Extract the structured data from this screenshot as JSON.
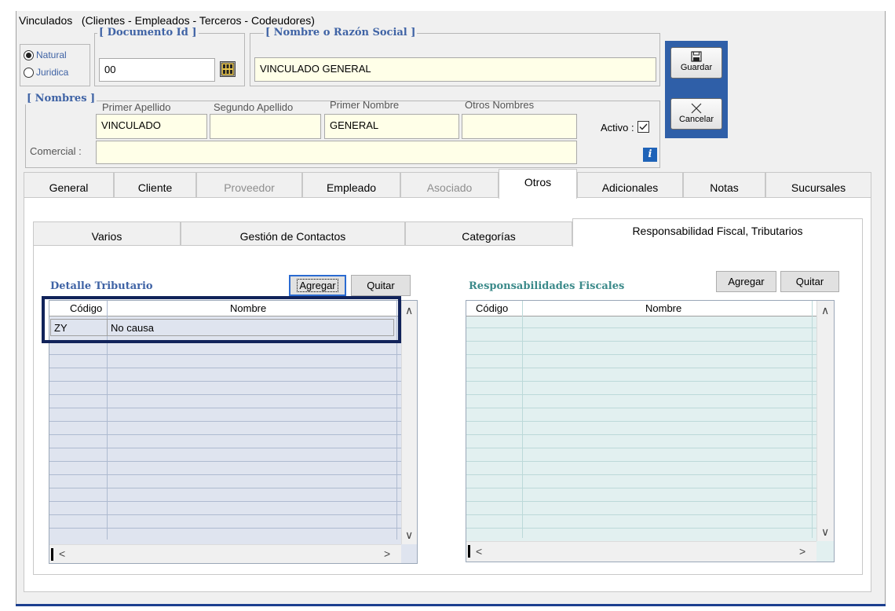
{
  "window": {
    "title": "Vinculados",
    "subtitle": "(Clientes - Empleados - Terceros - Codeudores)"
  },
  "person_type": {
    "natural_label": "Natural",
    "juridica_label": "Juridica",
    "selected": "Natural"
  },
  "documento": {
    "legend": "[ Documento Id ]",
    "value": "00"
  },
  "razon_social": {
    "legend": "[ Nombre o Razón Social ]",
    "value": "VINCULADO GENERAL"
  },
  "nombres": {
    "legend": "[ Nombres ]",
    "primer_apellido_label": "Primer Apellido",
    "primer_apellido_value": "VINCULADO",
    "segundo_apellido_label": "Segundo Apellido",
    "segundo_apellido_value": "",
    "primer_nombre_label": "Primer Nombre",
    "primer_nombre_value": "GENERAL",
    "otros_nombres_label": "Otros Nombres",
    "otros_nombres_value": "",
    "activo_label": "Activo :",
    "activo_checked": true,
    "comercial_label": "Comercial :",
    "comercial_value": "",
    "info_label": "i"
  },
  "actions": {
    "guardar": "Guardar",
    "cancelar": "Cancelar"
  },
  "tabs": [
    {
      "label": "General",
      "state": "normal"
    },
    {
      "label": "Cliente",
      "state": "normal"
    },
    {
      "label": "Proveedor",
      "state": "disabled"
    },
    {
      "label": "Empleado",
      "state": "normal"
    },
    {
      "label": "Asociado",
      "state": "disabled"
    },
    {
      "label": "Otros",
      "state": "active"
    },
    {
      "label": "Adicionales",
      "state": "normal"
    },
    {
      "label": "Notas",
      "state": "normal"
    },
    {
      "label": "Sucursales",
      "state": "normal"
    }
  ],
  "subtabs": [
    {
      "label": "Varios",
      "state": "normal"
    },
    {
      "label": "Gestión de Contactos",
      "state": "normal"
    },
    {
      "label": "Categorías",
      "state": "normal"
    },
    {
      "label": "Responsabilidad Fiscal, Tributarios",
      "state": "active"
    }
  ],
  "detalle_tributario": {
    "title": "Detalle Tributario",
    "agregar": "Agregar",
    "quitar": "Quitar",
    "columns": [
      "Código",
      "Nombre"
    ],
    "rows": [
      {
        "codigo": "ZY",
        "nombre": "No causa"
      }
    ]
  },
  "responsabilidades": {
    "title": "Responsabilidades Fiscales",
    "agregar": "Agregar",
    "quitar": "Quitar",
    "columns": [
      "Código",
      "Nombre"
    ],
    "rows": []
  },
  "colors": {
    "accent_blue": "#3f63a5",
    "accent_teal": "#3b8a8a",
    "field_yellow": "#ffffe8",
    "highlight_frame": "#11235a",
    "action_panel": "#2f5fa8"
  },
  "icons": {
    "lookup": "calculator-icon",
    "guardar": "floppy-disk-icon",
    "cancelar": "cancel-x-icon",
    "info": "info-icon"
  }
}
